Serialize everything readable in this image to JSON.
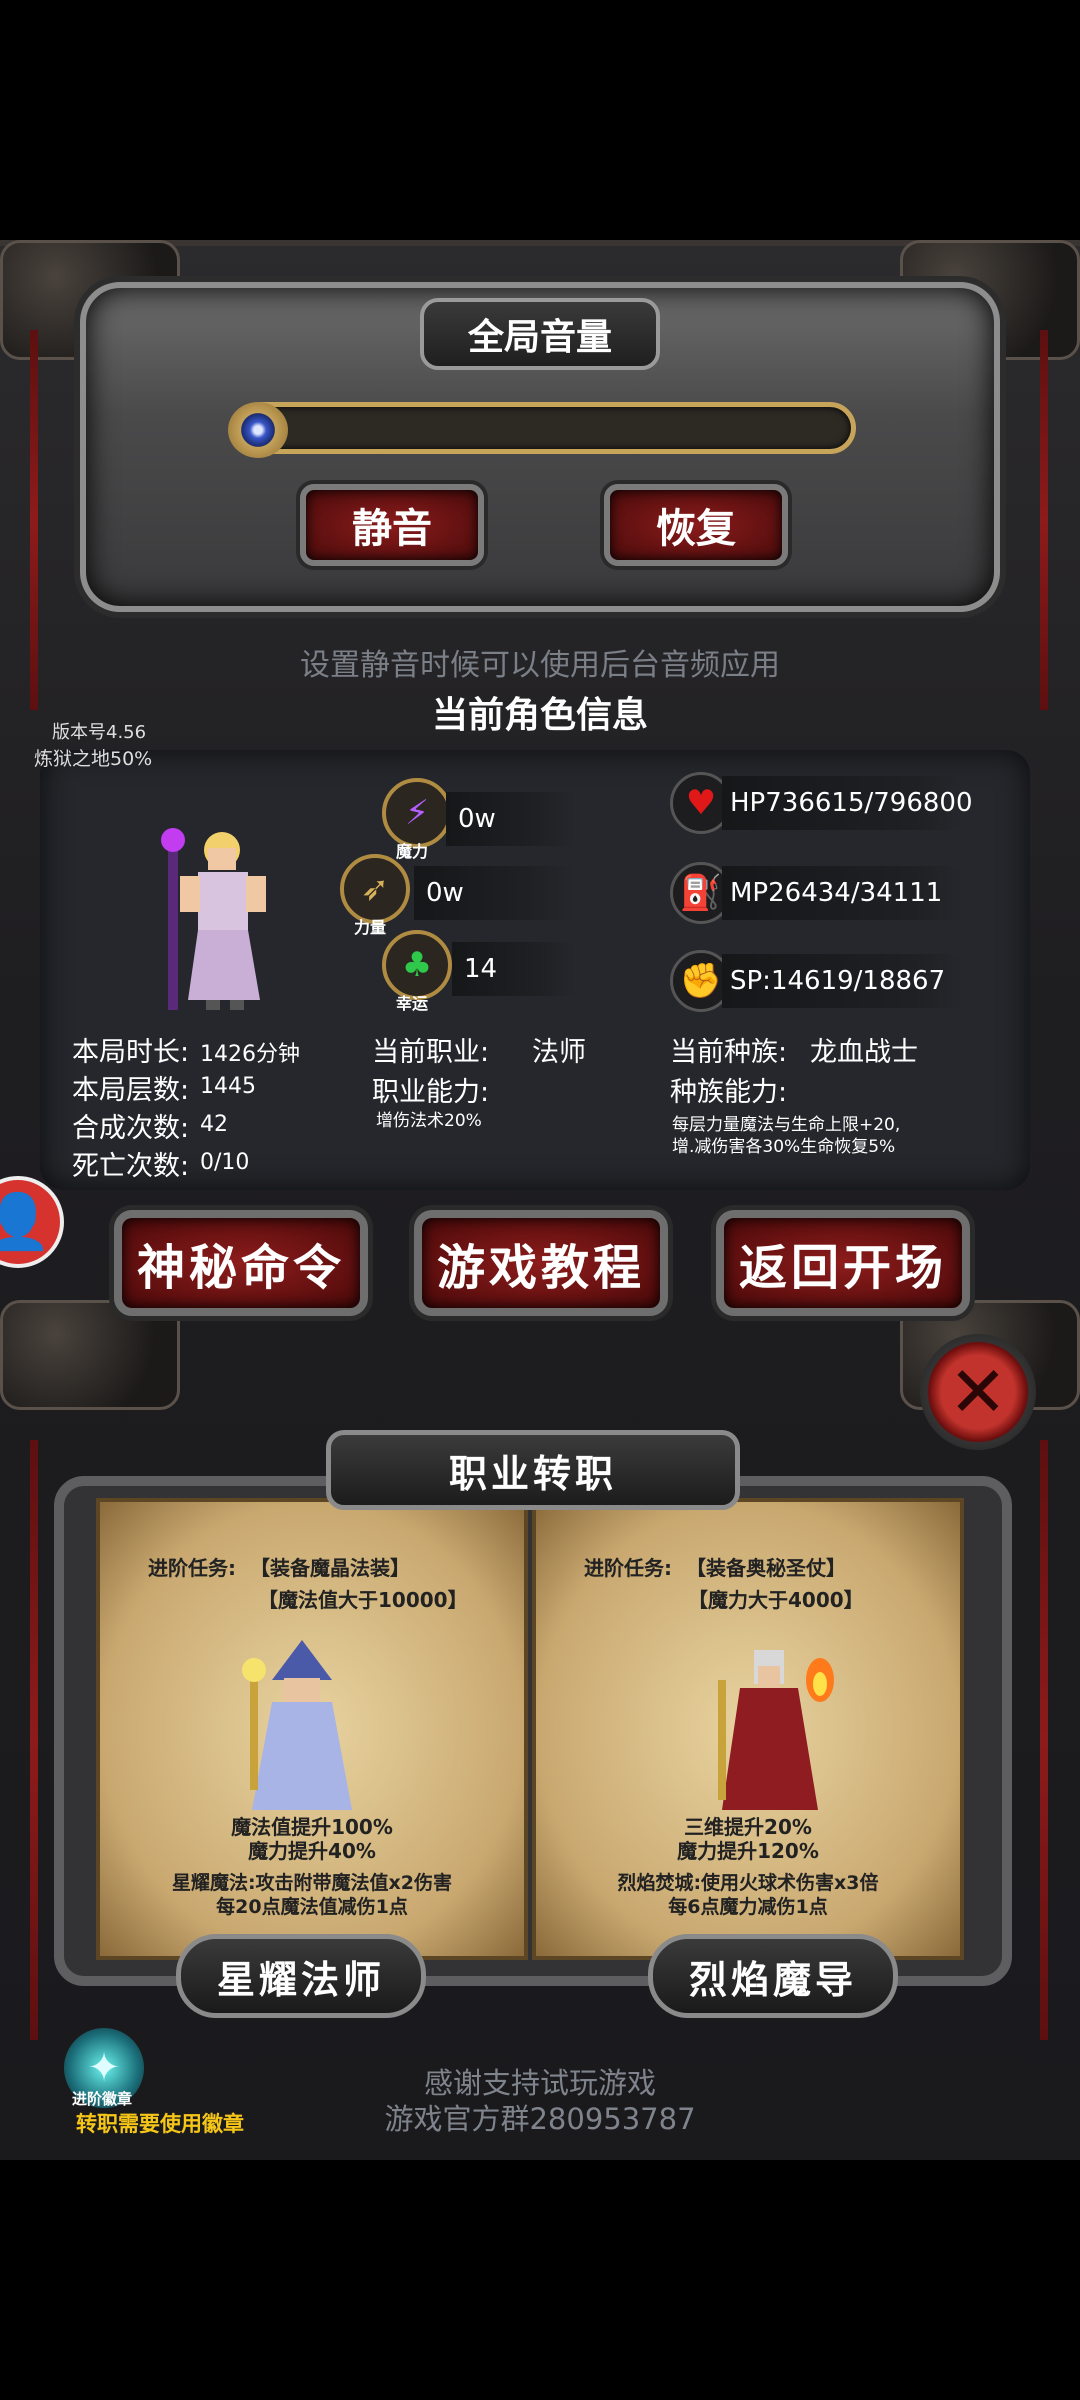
{
  "volume": {
    "title": "全局音量",
    "mute_label": "静音",
    "restore_label": "恢复",
    "hint": "设置静音时候可以使用后台音频应用",
    "level": 0.0
  },
  "character": {
    "section_title": "当前角色信息",
    "version": "版本号4.56",
    "purgatory": "炼狱之地50%",
    "stats": {
      "magic": {
        "label": "魔力",
        "value": "0w",
        "icon": "lightning-icon"
      },
      "strength": {
        "label": "力量",
        "value": "0w",
        "icon": "bow-icon"
      },
      "luck": {
        "label": "幸运",
        "value": "14",
        "icon": "clover-icon"
      }
    },
    "resources": {
      "hp": {
        "text": "HP736615/796800",
        "icon": "heart-icon"
      },
      "mp": {
        "text": "MP26434/34111",
        "icon": "mp-potion-icon"
      },
      "sp": {
        "text": "SP:14619/18867",
        "icon": "muscle-icon"
      }
    },
    "info": {
      "duration_label": "本局时长:",
      "duration_value": "1426分钟",
      "floors_label": "本局层数:",
      "floors_value": "1445",
      "synth_label": "合成次数:",
      "synth_value": "42",
      "death_label": "死亡次数:",
      "death_value": "0/10",
      "job_label": "当前职业:",
      "job_value": "法师",
      "job_ability_label": "职业能力:",
      "job_ability_value": "增伤法术20%",
      "race_label": "当前种族:",
      "race_value": "龙血战士",
      "race_ability_label": "种族能力:",
      "race_ability_line1": "每层力量魔法与生命上限+20,",
      "race_ability_line2": "增.减伤害各30%生命恢复5%"
    }
  },
  "actions": {
    "secret_command": "神秘命令",
    "tutorial": "游戏教程",
    "return_start": "返回开场"
  },
  "job_change": {
    "title": "职业转职",
    "left": {
      "task_prefix": "进阶任务:",
      "task_item": "【装备魔晶法装】",
      "task_req": "【魔法值大于10000】",
      "bonus1": "魔法值提升100%",
      "bonus2": "魔力提升40%",
      "skill1": "星耀魔法:攻击附带魔法值x2伤害",
      "skill2": "每20点魔法值减伤1点",
      "name": "星耀法师"
    },
    "right": {
      "task_prefix": "进阶任务:",
      "task_item": "【装备奥秘圣仗】",
      "task_req": "【魔力大于4000】",
      "bonus1": "三维提升20%",
      "bonus2": "魔力提升120%",
      "skill1": "烈焰焚城:使用火球术伤害x3倍",
      "skill2": "每6点魔力减伤1点",
      "name": "烈焰魔导"
    }
  },
  "footer": {
    "thanks": "感谢支持试玩游戏",
    "group": "游戏官方群280953787",
    "badge_label": "进阶徽章",
    "badge_note": "转职需要使用徽章"
  },
  "colors": {
    "accent_red": "#8e1c1c",
    "gold": "#c6a45a",
    "badge_yellow": "#f5c518"
  }
}
